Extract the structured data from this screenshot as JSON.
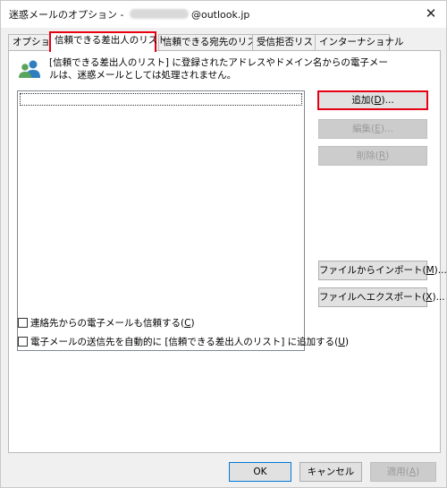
{
  "window": {
    "title_prefix": "迷惑メールのオプション - ",
    "title_suffix": "@outlook.jp",
    "close_glyph": "✕"
  },
  "tabs": [
    {
      "label": "オプション"
    },
    {
      "label": "信頼できる差出人のリスト"
    },
    {
      "label": "信頼できる宛先のリスト"
    },
    {
      "label": "受信拒否リスト"
    },
    {
      "label": "インターナショナル"
    }
  ],
  "panel": {
    "info_icon": "contacts-icon",
    "info_text": "[信頼できる差出人のリスト] に登録されたアドレスやドメイン名からの電子メールは、迷惑メールとしては処理されません。",
    "buttons": {
      "add": {
        "label": "追加(",
        "key": "D",
        "suffix": ")..."
      },
      "edit": {
        "label": "編集(",
        "key": "E",
        "suffix": ")..."
      },
      "delete": {
        "label": "削除(",
        "key": "R",
        "suffix": ")"
      },
      "import": {
        "label": "ファイルからインポート(",
        "key": "M",
        "suffix": ")..."
      },
      "export": {
        "label": "ファイルへエクスポート(",
        "key": "X",
        "suffix": ")..."
      }
    },
    "checkboxes": {
      "trust_contacts": {
        "label": "連絡先からの電子メールも信頼する(",
        "key": "C",
        "suffix": ")"
      },
      "auto_add": {
        "label": "電子メールの送信先を自動的に [信頼できる差出人のリスト] に追加する(",
        "key": "U",
        "suffix": ")"
      }
    }
  },
  "footer": {
    "ok": "OK",
    "cancel": "キャンセル",
    "apply": {
      "label": "適用(",
      "key": "A",
      "suffix": ")"
    }
  },
  "colors": {
    "highlight": "#e60012",
    "accent": "#0078d7"
  }
}
